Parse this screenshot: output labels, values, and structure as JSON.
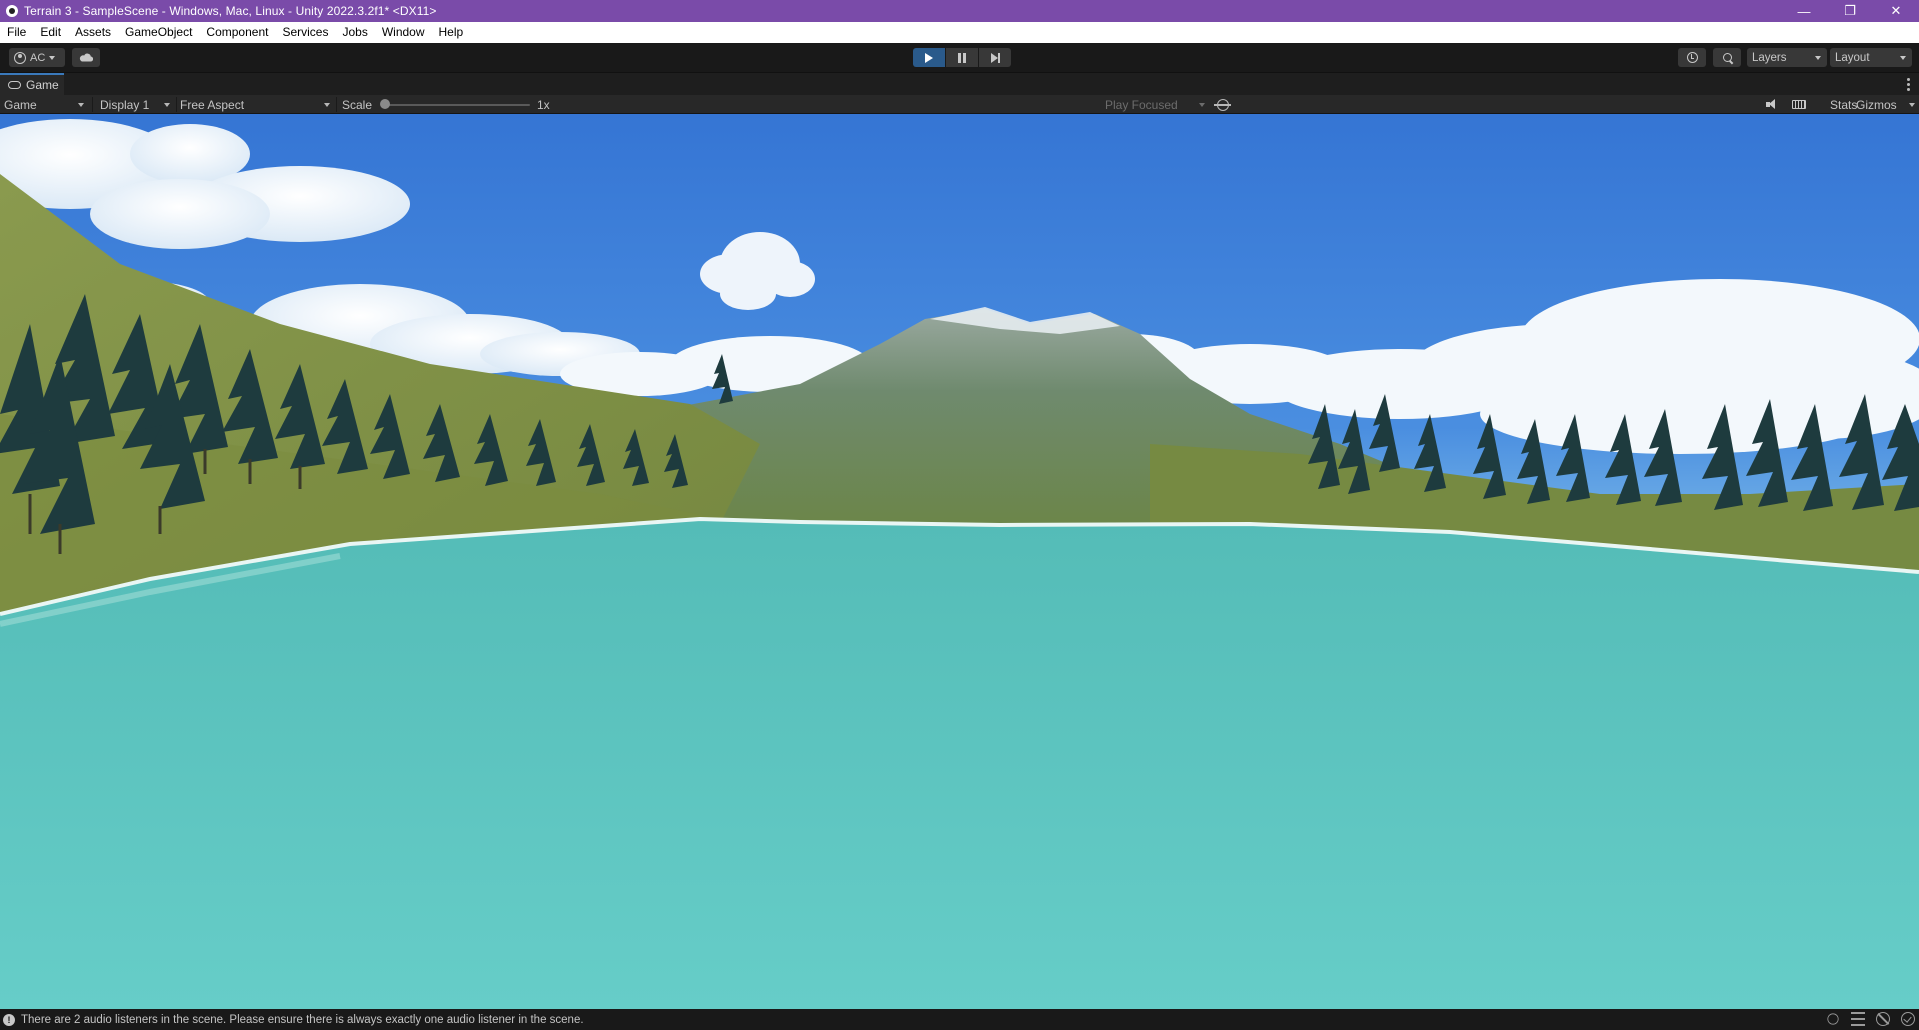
{
  "window": {
    "title": "Terrain 3 - SampleScene - Windows, Mac, Linux - Unity 2022.3.2f1* <DX11>",
    "controls": {
      "minimize": "—",
      "restore": "❐",
      "close": "✕"
    }
  },
  "menu": {
    "items": [
      "File",
      "Edit",
      "Assets",
      "GameObject",
      "Component",
      "Services",
      "Jobs",
      "Window",
      "Help"
    ]
  },
  "toolbar": {
    "account_label": "AC",
    "layers_label": "Layers",
    "layout_label": "Layout",
    "play_active": true
  },
  "game_tab": {
    "label": "Game"
  },
  "game_toolbar": {
    "view_mode": "Game",
    "display": "Display 1",
    "aspect": "Free Aspect",
    "scale_label": "Scale",
    "scale_value": "1x",
    "play_mode": "Play Focused",
    "stats_label": "Stats",
    "gizmos_label": "Gizmos"
  },
  "status": {
    "message": "There are 2 audio listeners in the scene. Please ensure there is always exactly one audio listener in the scene."
  },
  "colors": {
    "title_bar": "#7a4ba9",
    "play_active": "#2a5a8b",
    "sky_top": "#3a78d6",
    "sky_horizon": "#8ec9ef",
    "water": "#5bbfb9",
    "grass": "#7d8f44",
    "tree": "#1d3a3c"
  }
}
